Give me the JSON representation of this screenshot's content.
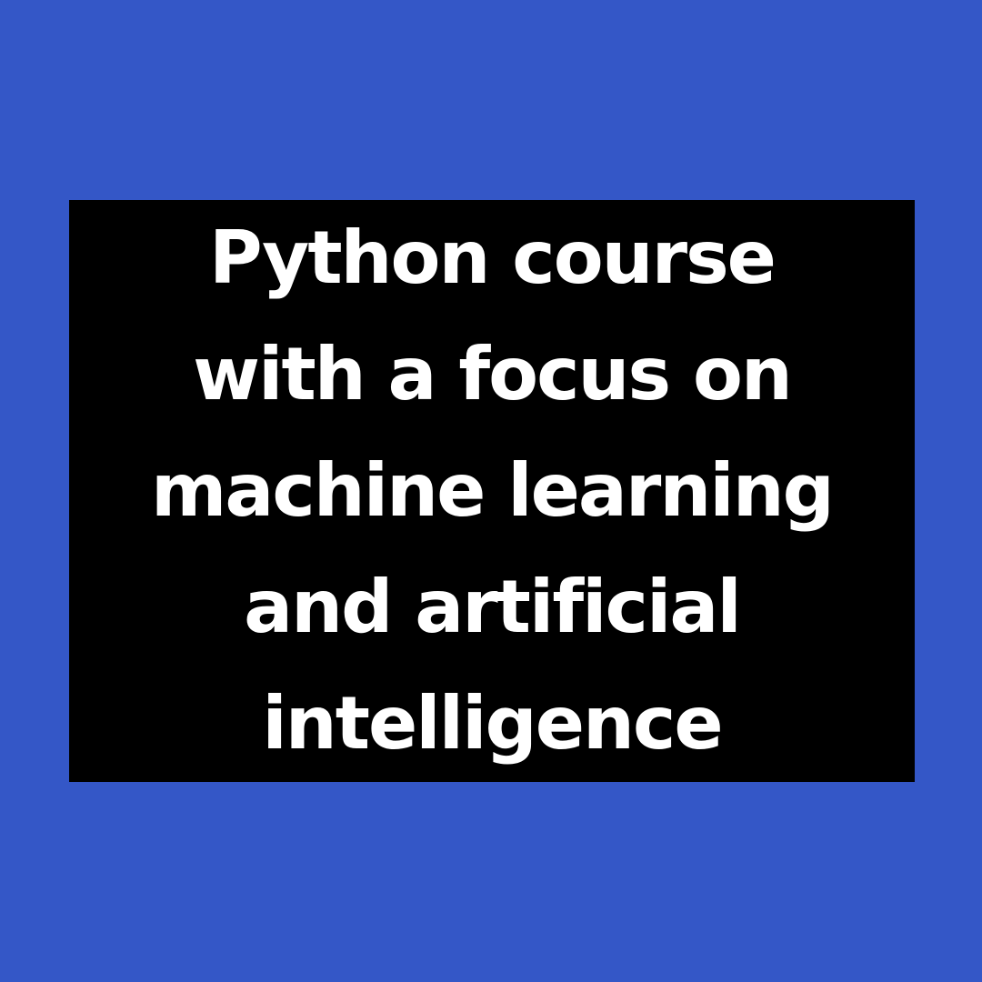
{
  "colors": {
    "background": "#3457c7",
    "panel": "#000000",
    "text": "#ffffff"
  },
  "headline": {
    "lines": [
      "Python course",
      "with a focus on",
      "machine learning",
      "and artificial",
      "intelligence"
    ]
  }
}
